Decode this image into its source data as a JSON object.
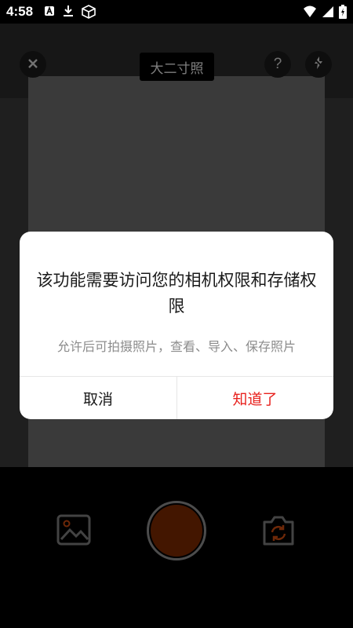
{
  "status_bar": {
    "time": "4:58",
    "left_icons": [
      "font-icon",
      "download-icon",
      "box-icon"
    ],
    "right_icons": [
      "wifi-icon",
      "signal-icon",
      "battery-charging-icon"
    ]
  },
  "camera": {
    "size_label": "大二寸照",
    "top_icons": [
      "close-icon",
      "help-icon",
      "flash-off-icon"
    ]
  },
  "dialog": {
    "title": "该功能需要访问您的相机权限和存储权限",
    "message": "允许后可拍摄照片，查看、导入、保存照片",
    "cancel_label": "取消",
    "confirm_label": "知道了",
    "confirm_color": "#e8211d"
  },
  "bottom_controls": {
    "icons": [
      "gallery-icon",
      "shutter-button",
      "switch-camera-icon"
    ],
    "shutter_color": "#7a2800",
    "switch_accent": "#c84a10"
  }
}
